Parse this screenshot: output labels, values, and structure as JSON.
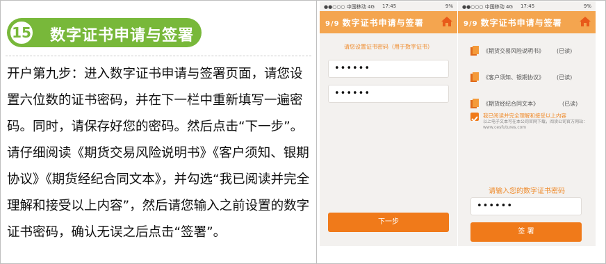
{
  "step": {
    "number": "15",
    "title": "数字证书申请与签署"
  },
  "instructions": "开户第九步：进入数字证书申请与签署页面，请您设置六位数的证书密码，并在下一栏中重新填写一遍密码。同时，请保存好您的密码。然后点击“下一步”。请仔细阅读《期货交易风险说明书》《客户须知、银期协议》《期货经纪合同文本》，并勾选“我已阅读并完全理解和接受以上内容”，然后请您输入之前设置的数字证书密码，确认无误之后点击“签署”。",
  "phone1": {
    "status_left": "●●○○○ 中国移动 4G",
    "status_time": "17:45",
    "status_right": "9%",
    "page": "9/9",
    "title": "数字证书申请与签署",
    "hint": "请您设置证书密码（用于数字证书）",
    "password1": "••••••",
    "password2": "••••••",
    "next_label": "下一步"
  },
  "phone2": {
    "status_left": "●●○○○ 中国移动 4G",
    "status_time": "17:45",
    "status_right": "9%",
    "page": "9/9",
    "title": "数字证书申请与签署",
    "docs": [
      {
        "name": "《期货交易风险说明书》",
        "status": "(已读)"
      },
      {
        "name": "《客户须知、银期协议》",
        "status": "(已读)"
      },
      {
        "name": "《期货经纪合同文本》",
        "status": "(已读)"
      }
    ],
    "agree": "我已阅读并完全理解和接受以上内容",
    "note": "以上电子文本可在本公司官网下载，阅读公司官方网站：www.cesfutures.com",
    "password_prompt": "请输入您的数字证书密码",
    "password": "••••••",
    "sign_label": "签 署"
  },
  "colors": {
    "accent_green": "#78b83a",
    "nav_orange": "#f4a54f",
    "button_orange": "#f07a1a"
  }
}
